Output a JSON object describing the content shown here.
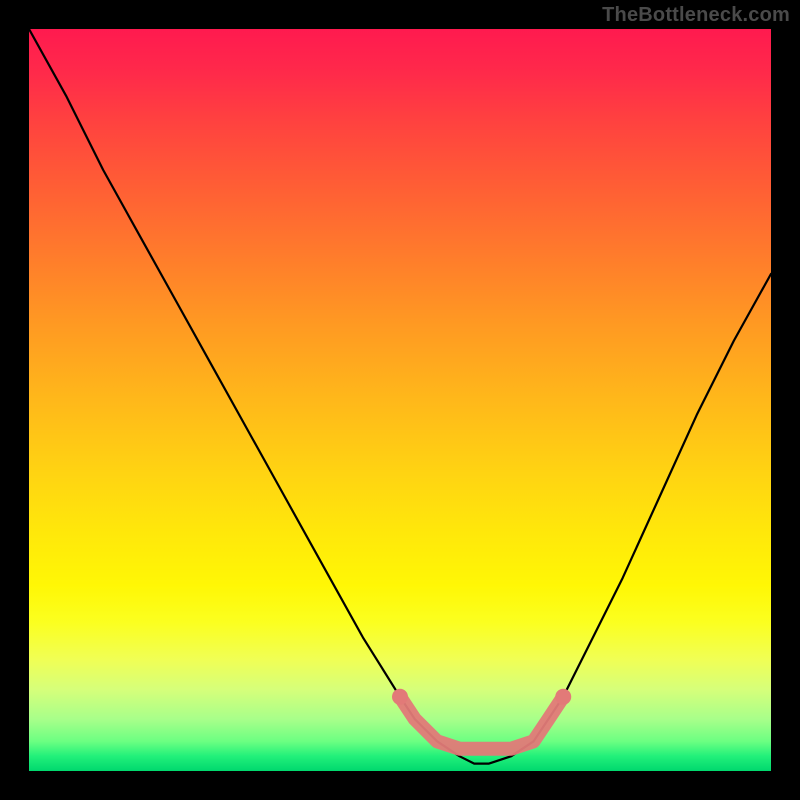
{
  "watermark": "TheBottleneck.com",
  "chart_data": {
    "type": "line",
    "title": "",
    "xlabel": "",
    "ylabel": "",
    "xlim": [
      0,
      100
    ],
    "ylim": [
      0,
      100
    ],
    "grid": false,
    "legend": false,
    "series": [
      {
        "name": "bottleneck-curve",
        "x": [
          0,
          5,
          10,
          15,
          20,
          25,
          30,
          35,
          40,
          45,
          50,
          52,
          55,
          58,
          60,
          62,
          65,
          68,
          70,
          72,
          75,
          80,
          85,
          90,
          95,
          100
        ],
        "values": [
          100,
          91,
          81,
          72,
          63,
          54,
          45,
          36,
          27,
          18,
          10,
          7,
          4,
          2,
          1,
          1,
          2,
          4,
          7,
          10,
          16,
          26,
          37,
          48,
          58,
          67
        ]
      }
    ],
    "axis_note": "no ticks or labels visible in image",
    "highlight_band": {
      "color": "#e27a78",
      "x_start": 50,
      "x_end": 72,
      "y_level": 4,
      "endpoints": [
        {
          "x": 50,
          "y": 10
        },
        {
          "x": 72,
          "y": 10
        }
      ]
    },
    "background_gradient": {
      "direction": "vertical",
      "stops": [
        {
          "pos": 0,
          "color": "#ff1a4f"
        },
        {
          "pos": 50,
          "color": "#ffb81a"
        },
        {
          "pos": 80,
          "color": "#fbff20"
        },
        {
          "pos": 100,
          "color": "#00d86e"
        }
      ]
    }
  }
}
